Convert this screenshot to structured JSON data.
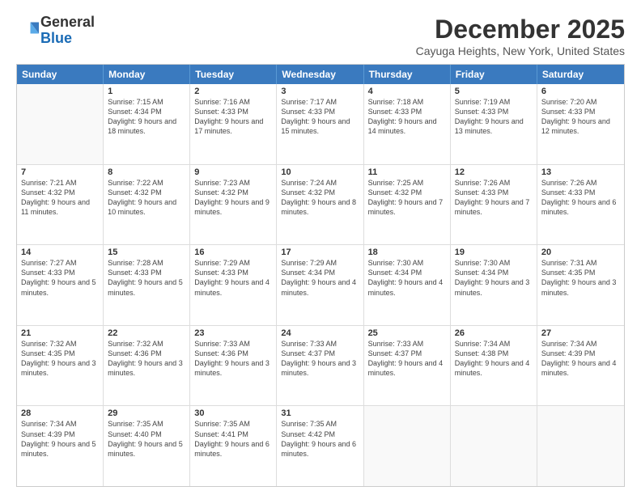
{
  "header": {
    "logo_line1": "General",
    "logo_line2": "Blue",
    "month_title": "December 2025",
    "location": "Cayuga Heights, New York, United States"
  },
  "days_of_week": [
    "Sunday",
    "Monday",
    "Tuesday",
    "Wednesday",
    "Thursday",
    "Friday",
    "Saturday"
  ],
  "weeks": [
    [
      {
        "day": null,
        "sunrise": null,
        "sunset": null,
        "daylight": null
      },
      {
        "day": "1",
        "sunrise": "Sunrise: 7:15 AM",
        "sunset": "Sunset: 4:34 PM",
        "daylight": "Daylight: 9 hours and 18 minutes."
      },
      {
        "day": "2",
        "sunrise": "Sunrise: 7:16 AM",
        "sunset": "Sunset: 4:33 PM",
        "daylight": "Daylight: 9 hours and 17 minutes."
      },
      {
        "day": "3",
        "sunrise": "Sunrise: 7:17 AM",
        "sunset": "Sunset: 4:33 PM",
        "daylight": "Daylight: 9 hours and 15 minutes."
      },
      {
        "day": "4",
        "sunrise": "Sunrise: 7:18 AM",
        "sunset": "Sunset: 4:33 PM",
        "daylight": "Daylight: 9 hours and 14 minutes."
      },
      {
        "day": "5",
        "sunrise": "Sunrise: 7:19 AM",
        "sunset": "Sunset: 4:33 PM",
        "daylight": "Daylight: 9 hours and 13 minutes."
      },
      {
        "day": "6",
        "sunrise": "Sunrise: 7:20 AM",
        "sunset": "Sunset: 4:33 PM",
        "daylight": "Daylight: 9 hours and 12 minutes."
      }
    ],
    [
      {
        "day": "7",
        "sunrise": "Sunrise: 7:21 AM",
        "sunset": "Sunset: 4:32 PM",
        "daylight": "Daylight: 9 hours and 11 minutes."
      },
      {
        "day": "8",
        "sunrise": "Sunrise: 7:22 AM",
        "sunset": "Sunset: 4:32 PM",
        "daylight": "Daylight: 9 hours and 10 minutes."
      },
      {
        "day": "9",
        "sunrise": "Sunrise: 7:23 AM",
        "sunset": "Sunset: 4:32 PM",
        "daylight": "Daylight: 9 hours and 9 minutes."
      },
      {
        "day": "10",
        "sunrise": "Sunrise: 7:24 AM",
        "sunset": "Sunset: 4:32 PM",
        "daylight": "Daylight: 9 hours and 8 minutes."
      },
      {
        "day": "11",
        "sunrise": "Sunrise: 7:25 AM",
        "sunset": "Sunset: 4:32 PM",
        "daylight": "Daylight: 9 hours and 7 minutes."
      },
      {
        "day": "12",
        "sunrise": "Sunrise: 7:26 AM",
        "sunset": "Sunset: 4:33 PM",
        "daylight": "Daylight: 9 hours and 7 minutes."
      },
      {
        "day": "13",
        "sunrise": "Sunrise: 7:26 AM",
        "sunset": "Sunset: 4:33 PM",
        "daylight": "Daylight: 9 hours and 6 minutes."
      }
    ],
    [
      {
        "day": "14",
        "sunrise": "Sunrise: 7:27 AM",
        "sunset": "Sunset: 4:33 PM",
        "daylight": "Daylight: 9 hours and 5 minutes."
      },
      {
        "day": "15",
        "sunrise": "Sunrise: 7:28 AM",
        "sunset": "Sunset: 4:33 PM",
        "daylight": "Daylight: 9 hours and 5 minutes."
      },
      {
        "day": "16",
        "sunrise": "Sunrise: 7:29 AM",
        "sunset": "Sunset: 4:33 PM",
        "daylight": "Daylight: 9 hours and 4 minutes."
      },
      {
        "day": "17",
        "sunrise": "Sunrise: 7:29 AM",
        "sunset": "Sunset: 4:34 PM",
        "daylight": "Daylight: 9 hours and 4 minutes."
      },
      {
        "day": "18",
        "sunrise": "Sunrise: 7:30 AM",
        "sunset": "Sunset: 4:34 PM",
        "daylight": "Daylight: 9 hours and 4 minutes."
      },
      {
        "day": "19",
        "sunrise": "Sunrise: 7:30 AM",
        "sunset": "Sunset: 4:34 PM",
        "daylight": "Daylight: 9 hours and 3 minutes."
      },
      {
        "day": "20",
        "sunrise": "Sunrise: 7:31 AM",
        "sunset": "Sunset: 4:35 PM",
        "daylight": "Daylight: 9 hours and 3 minutes."
      }
    ],
    [
      {
        "day": "21",
        "sunrise": "Sunrise: 7:32 AM",
        "sunset": "Sunset: 4:35 PM",
        "daylight": "Daylight: 9 hours and 3 minutes."
      },
      {
        "day": "22",
        "sunrise": "Sunrise: 7:32 AM",
        "sunset": "Sunset: 4:36 PM",
        "daylight": "Daylight: 9 hours and 3 minutes."
      },
      {
        "day": "23",
        "sunrise": "Sunrise: 7:33 AM",
        "sunset": "Sunset: 4:36 PM",
        "daylight": "Daylight: 9 hours and 3 minutes."
      },
      {
        "day": "24",
        "sunrise": "Sunrise: 7:33 AM",
        "sunset": "Sunset: 4:37 PM",
        "daylight": "Daylight: 9 hours and 3 minutes."
      },
      {
        "day": "25",
        "sunrise": "Sunrise: 7:33 AM",
        "sunset": "Sunset: 4:37 PM",
        "daylight": "Daylight: 9 hours and 4 minutes."
      },
      {
        "day": "26",
        "sunrise": "Sunrise: 7:34 AM",
        "sunset": "Sunset: 4:38 PM",
        "daylight": "Daylight: 9 hours and 4 minutes."
      },
      {
        "day": "27",
        "sunrise": "Sunrise: 7:34 AM",
        "sunset": "Sunset: 4:39 PM",
        "daylight": "Daylight: 9 hours and 4 minutes."
      }
    ],
    [
      {
        "day": "28",
        "sunrise": "Sunrise: 7:34 AM",
        "sunset": "Sunset: 4:39 PM",
        "daylight": "Daylight: 9 hours and 5 minutes."
      },
      {
        "day": "29",
        "sunrise": "Sunrise: 7:35 AM",
        "sunset": "Sunset: 4:40 PM",
        "daylight": "Daylight: 9 hours and 5 minutes."
      },
      {
        "day": "30",
        "sunrise": "Sunrise: 7:35 AM",
        "sunset": "Sunset: 4:41 PM",
        "daylight": "Daylight: 9 hours and 6 minutes."
      },
      {
        "day": "31",
        "sunrise": "Sunrise: 7:35 AM",
        "sunset": "Sunset: 4:42 PM",
        "daylight": "Daylight: 9 hours and 6 minutes."
      },
      {
        "day": null,
        "sunrise": null,
        "sunset": null,
        "daylight": null
      },
      {
        "day": null,
        "sunrise": null,
        "sunset": null,
        "daylight": null
      },
      {
        "day": null,
        "sunrise": null,
        "sunset": null,
        "daylight": null
      }
    ]
  ]
}
